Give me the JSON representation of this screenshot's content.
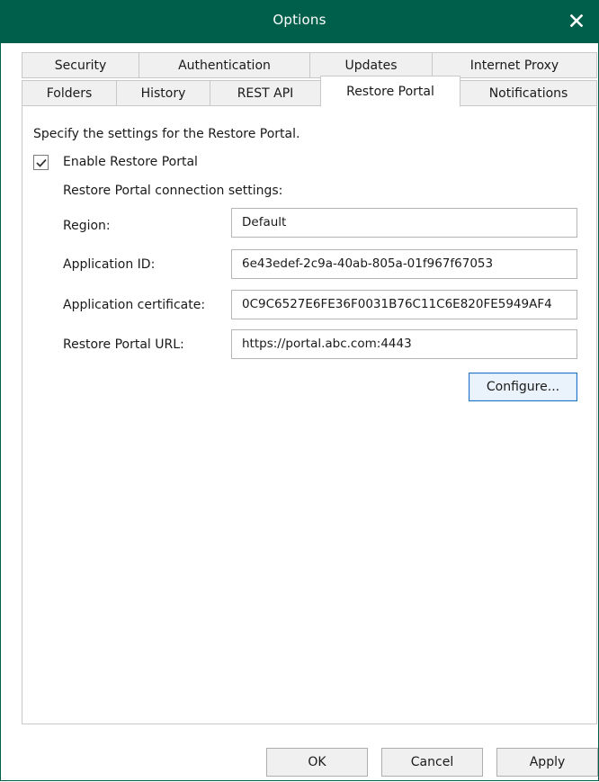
{
  "window": {
    "title": "Options",
    "colors": {
      "titlebar": "#005f4b",
      "accent_button_border": "#1e74c8"
    }
  },
  "tabs_row1": [
    {
      "label": "Security"
    },
    {
      "label": "Authentication"
    },
    {
      "label": "Updates"
    },
    {
      "label": "Internet Proxy"
    }
  ],
  "tabs_row2": [
    {
      "label": "Folders"
    },
    {
      "label": "History"
    },
    {
      "label": "REST API"
    },
    {
      "label": "Restore Portal",
      "active": true
    },
    {
      "label": "Notifications"
    }
  ],
  "panel": {
    "description": "Specify the settings for the Restore Portal.",
    "enable_checkbox": {
      "label": "Enable Restore Portal",
      "checked": true
    },
    "section_heading": "Restore Portal connection settings:",
    "fields": {
      "region": {
        "label": "Region:",
        "value": "Default"
      },
      "application_id": {
        "label": "Application ID:",
        "value": "6e43edef-2c9a-40ab-805a-01f967f67053"
      },
      "application_certificate": {
        "label": "Application certificate:",
        "value": "0C9C6527E6FE36F0031B76C11C6E820FE5949AF4"
      },
      "restore_portal_url": {
        "label": "Restore Portal URL:",
        "value": "https://portal.abc.com:4443"
      }
    },
    "configure_button": "Configure..."
  },
  "footer": {
    "ok": "OK",
    "cancel": "Cancel",
    "apply": "Apply"
  },
  "icons": {
    "close": "close-icon",
    "check": "checkmark-icon"
  }
}
